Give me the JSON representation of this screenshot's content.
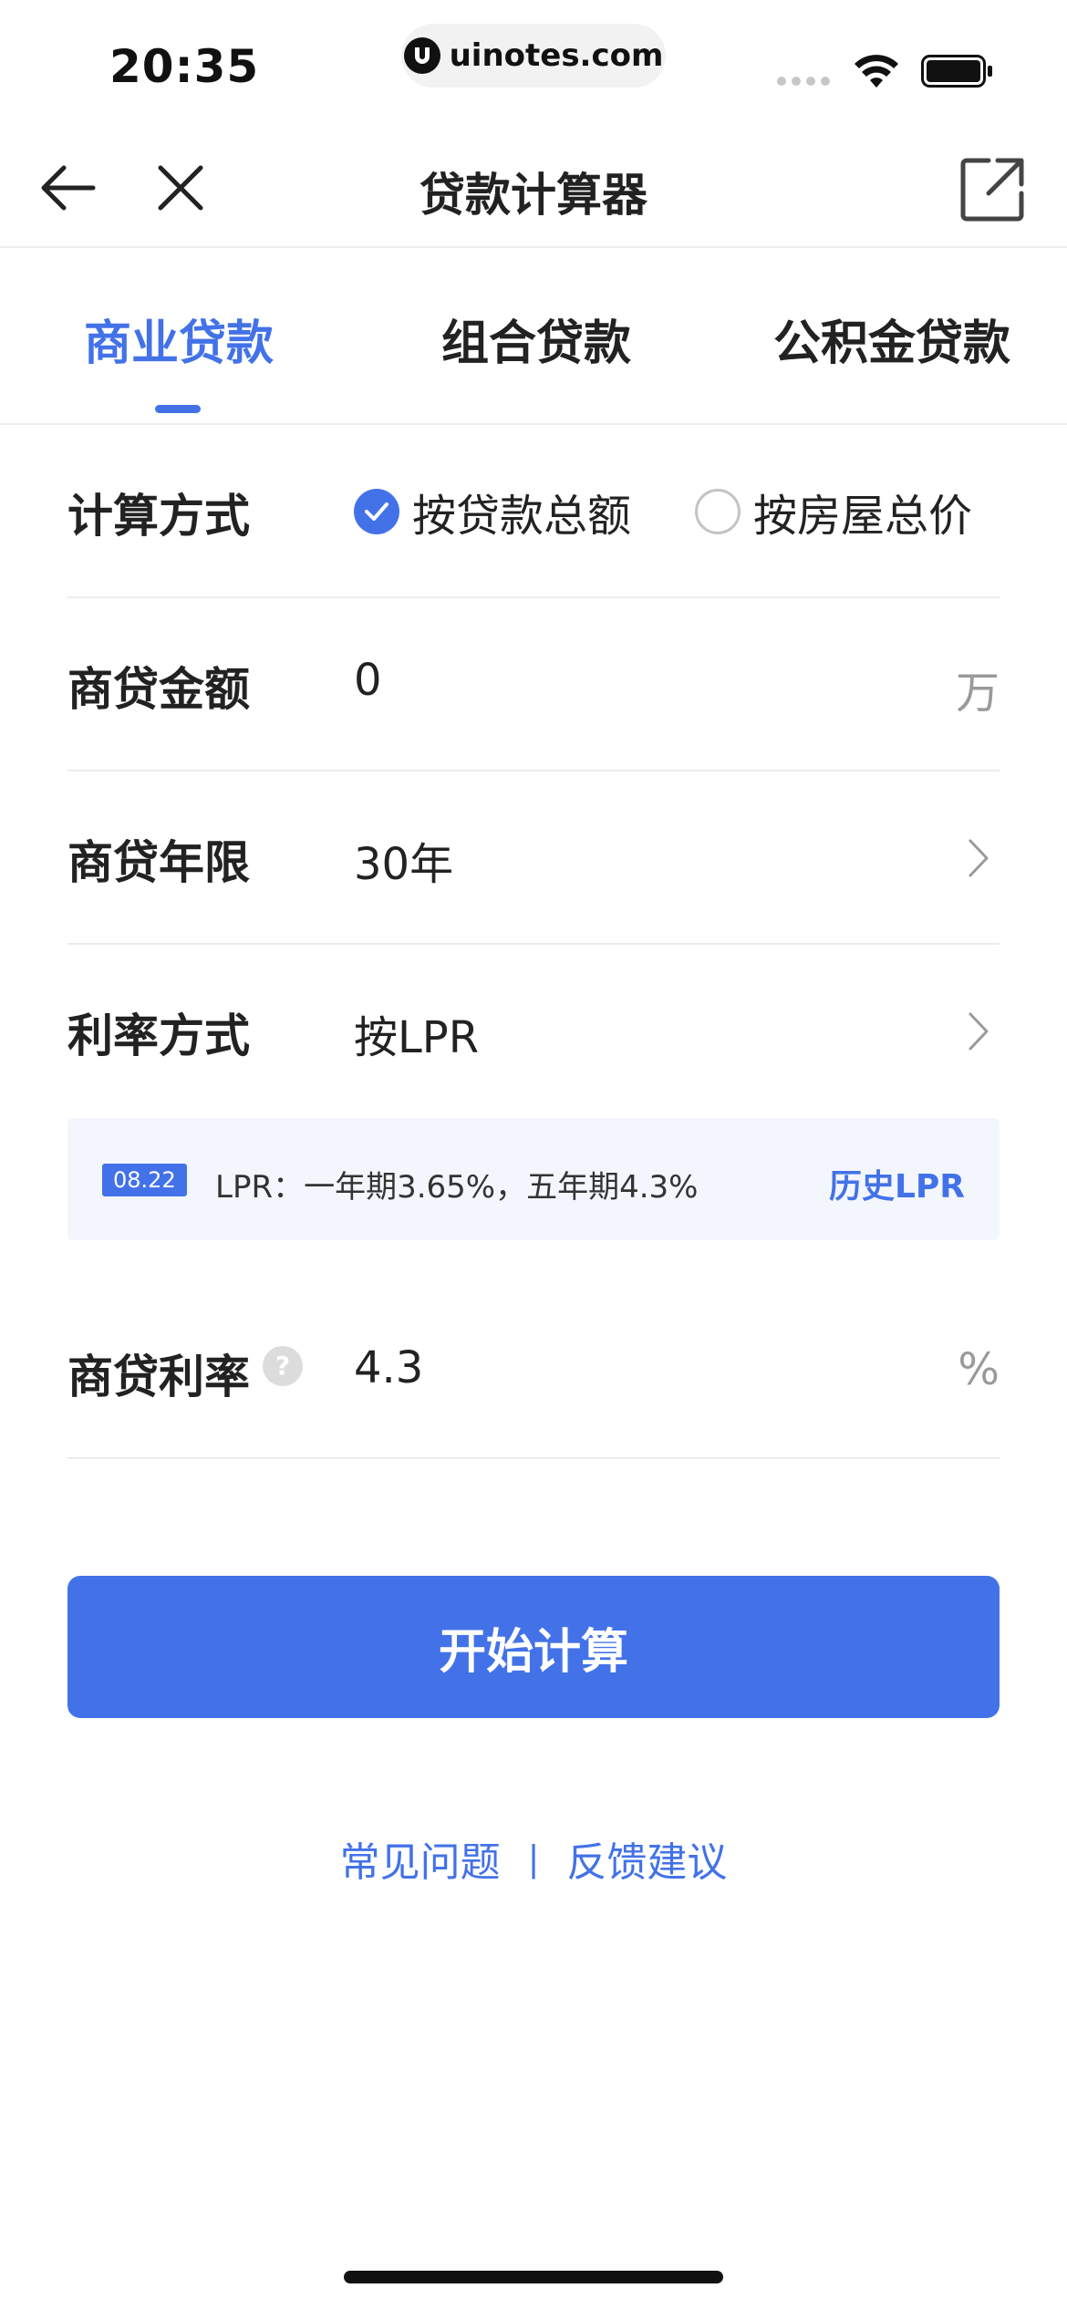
{
  "status_bar": {
    "time": "20:35",
    "url": "uinotes.com",
    "icons": [
      "signal-icon",
      "wifi-icon",
      "battery-icon"
    ]
  },
  "nav": {
    "title": "贷款计算器",
    "icons": [
      "back-arrow-icon",
      "close-icon",
      "share-icon"
    ]
  },
  "tabs": [
    {
      "label": "商业贷款",
      "active": true
    },
    {
      "label": "组合贷款",
      "active": false
    },
    {
      "label": "公积金贷款",
      "active": false
    }
  ],
  "form": {
    "calc_method": {
      "label": "计算方式",
      "options": [
        {
          "label": "按贷款总额",
          "checked": true
        },
        {
          "label": "按房屋总价",
          "checked": false
        }
      ]
    },
    "loan_amount": {
      "label": "商贷金额",
      "value": "0",
      "unit": "万"
    },
    "loan_term": {
      "label": "商贷年限",
      "value": "30年"
    },
    "rate_method": {
      "label": "利率方式",
      "value": "按LPR"
    },
    "lpr": {
      "date": "08.22",
      "text": "LPR：一年期3.65%，五年期4.3%",
      "history_link": "历史LPR"
    },
    "loan_rate": {
      "label": "商贷利率",
      "help": "?",
      "value": "4.3",
      "unit": "%"
    }
  },
  "actions": {
    "calculate": "开始计算"
  },
  "footer": {
    "faq": "常见问题",
    "separator": "|",
    "feedback": "反馈建议"
  },
  "colors": {
    "accent": "#4372e8",
    "text": "#222222",
    "muted": "#9a9a9a",
    "divider": "#ececec"
  }
}
